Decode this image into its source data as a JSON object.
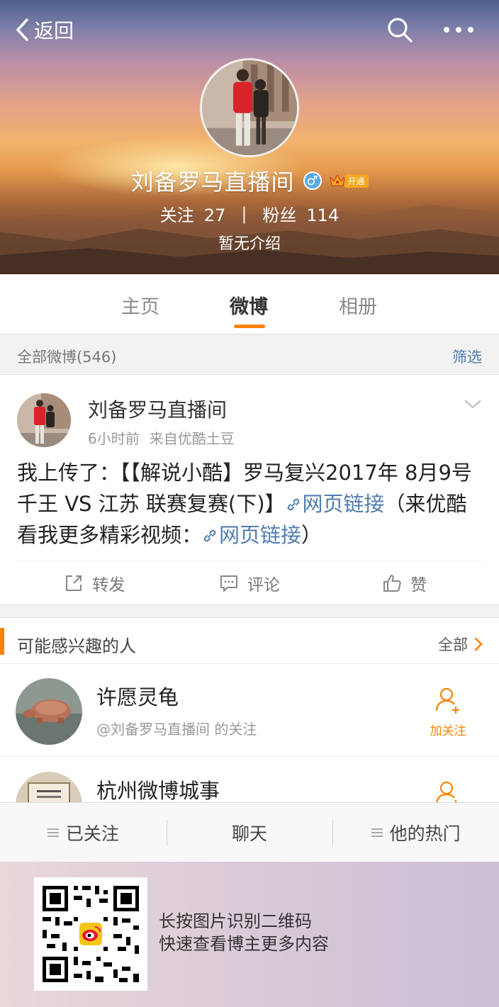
{
  "header": {
    "back_label": "返回",
    "profile_name": "刘备罗马直播间",
    "gender_symbol": "♂",
    "vip_label": "开通",
    "following_label": "关注",
    "following_count": "27",
    "divider": "|",
    "fans_label": "粉丝",
    "fans_count": "114",
    "intro": "暂无介绍"
  },
  "tabs": [
    {
      "label": "主页",
      "active": false
    },
    {
      "label": "微博",
      "active": true
    },
    {
      "label": "相册",
      "active": false
    }
  ],
  "filter_bar": {
    "summary": "全部微博(546)",
    "filter_label": "筛选"
  },
  "post": {
    "author": "刘备罗马直播间",
    "time": "6小时前",
    "source": "来自优酷土豆",
    "text_part1": "我上传了：【【解说小酷】罗马复兴2017年 8月9号 千王 VS 江苏 联赛复赛(下)】",
    "link1": "网页链接",
    "text_part2": "（来优酷看我更多精彩视频：",
    "link2": "网页链接",
    "text_part3": "）",
    "actions": {
      "repost": "转发",
      "comment": "评论",
      "like": "赞"
    }
  },
  "suggestions": {
    "title": "可能感兴趣的人",
    "all_label": "全部",
    "people": [
      {
        "name": "许愿灵龟",
        "subtitle": "@刘备罗马直播间 的关注",
        "follow_label": "加关注"
      },
      {
        "name": "杭州微博城事",
        "subtitle": "",
        "follow_label": "加关注"
      }
    ]
  },
  "toolbar": {
    "followed": "已关注",
    "chat": "聊天",
    "hot": "他的热门"
  },
  "qr": {
    "line1": "长按图片识别二维码",
    "line2": "快速查看博主更多内容"
  },
  "colors": {
    "accent": "#ff8200",
    "link": "#507daf",
    "gender_badge": "#5aa9e6"
  }
}
